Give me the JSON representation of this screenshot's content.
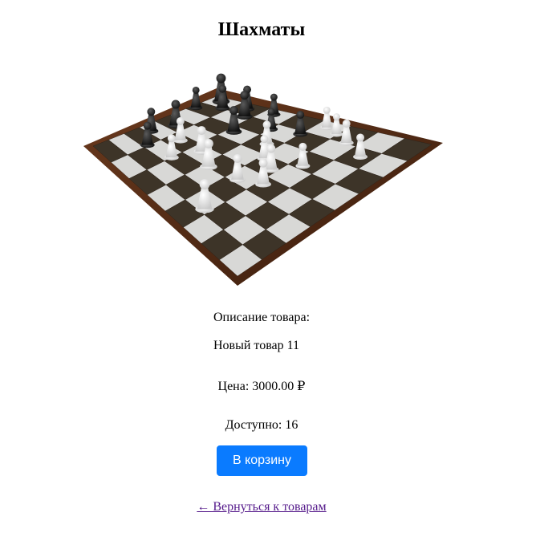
{
  "product": {
    "title": "Шахматы",
    "image_alt": "chessboard-photo",
    "description_label": "Описание товара:",
    "description": "Новый товар 11",
    "price": "Цена: 3000.00 ₽",
    "stock": "Доступно: 16"
  },
  "actions": {
    "add_to_cart_label": "В корзину",
    "back_link_label": "← Вернуться к товарам"
  },
  "colors": {
    "button_bg": "#0a7bff",
    "link": "#551a8b"
  }
}
